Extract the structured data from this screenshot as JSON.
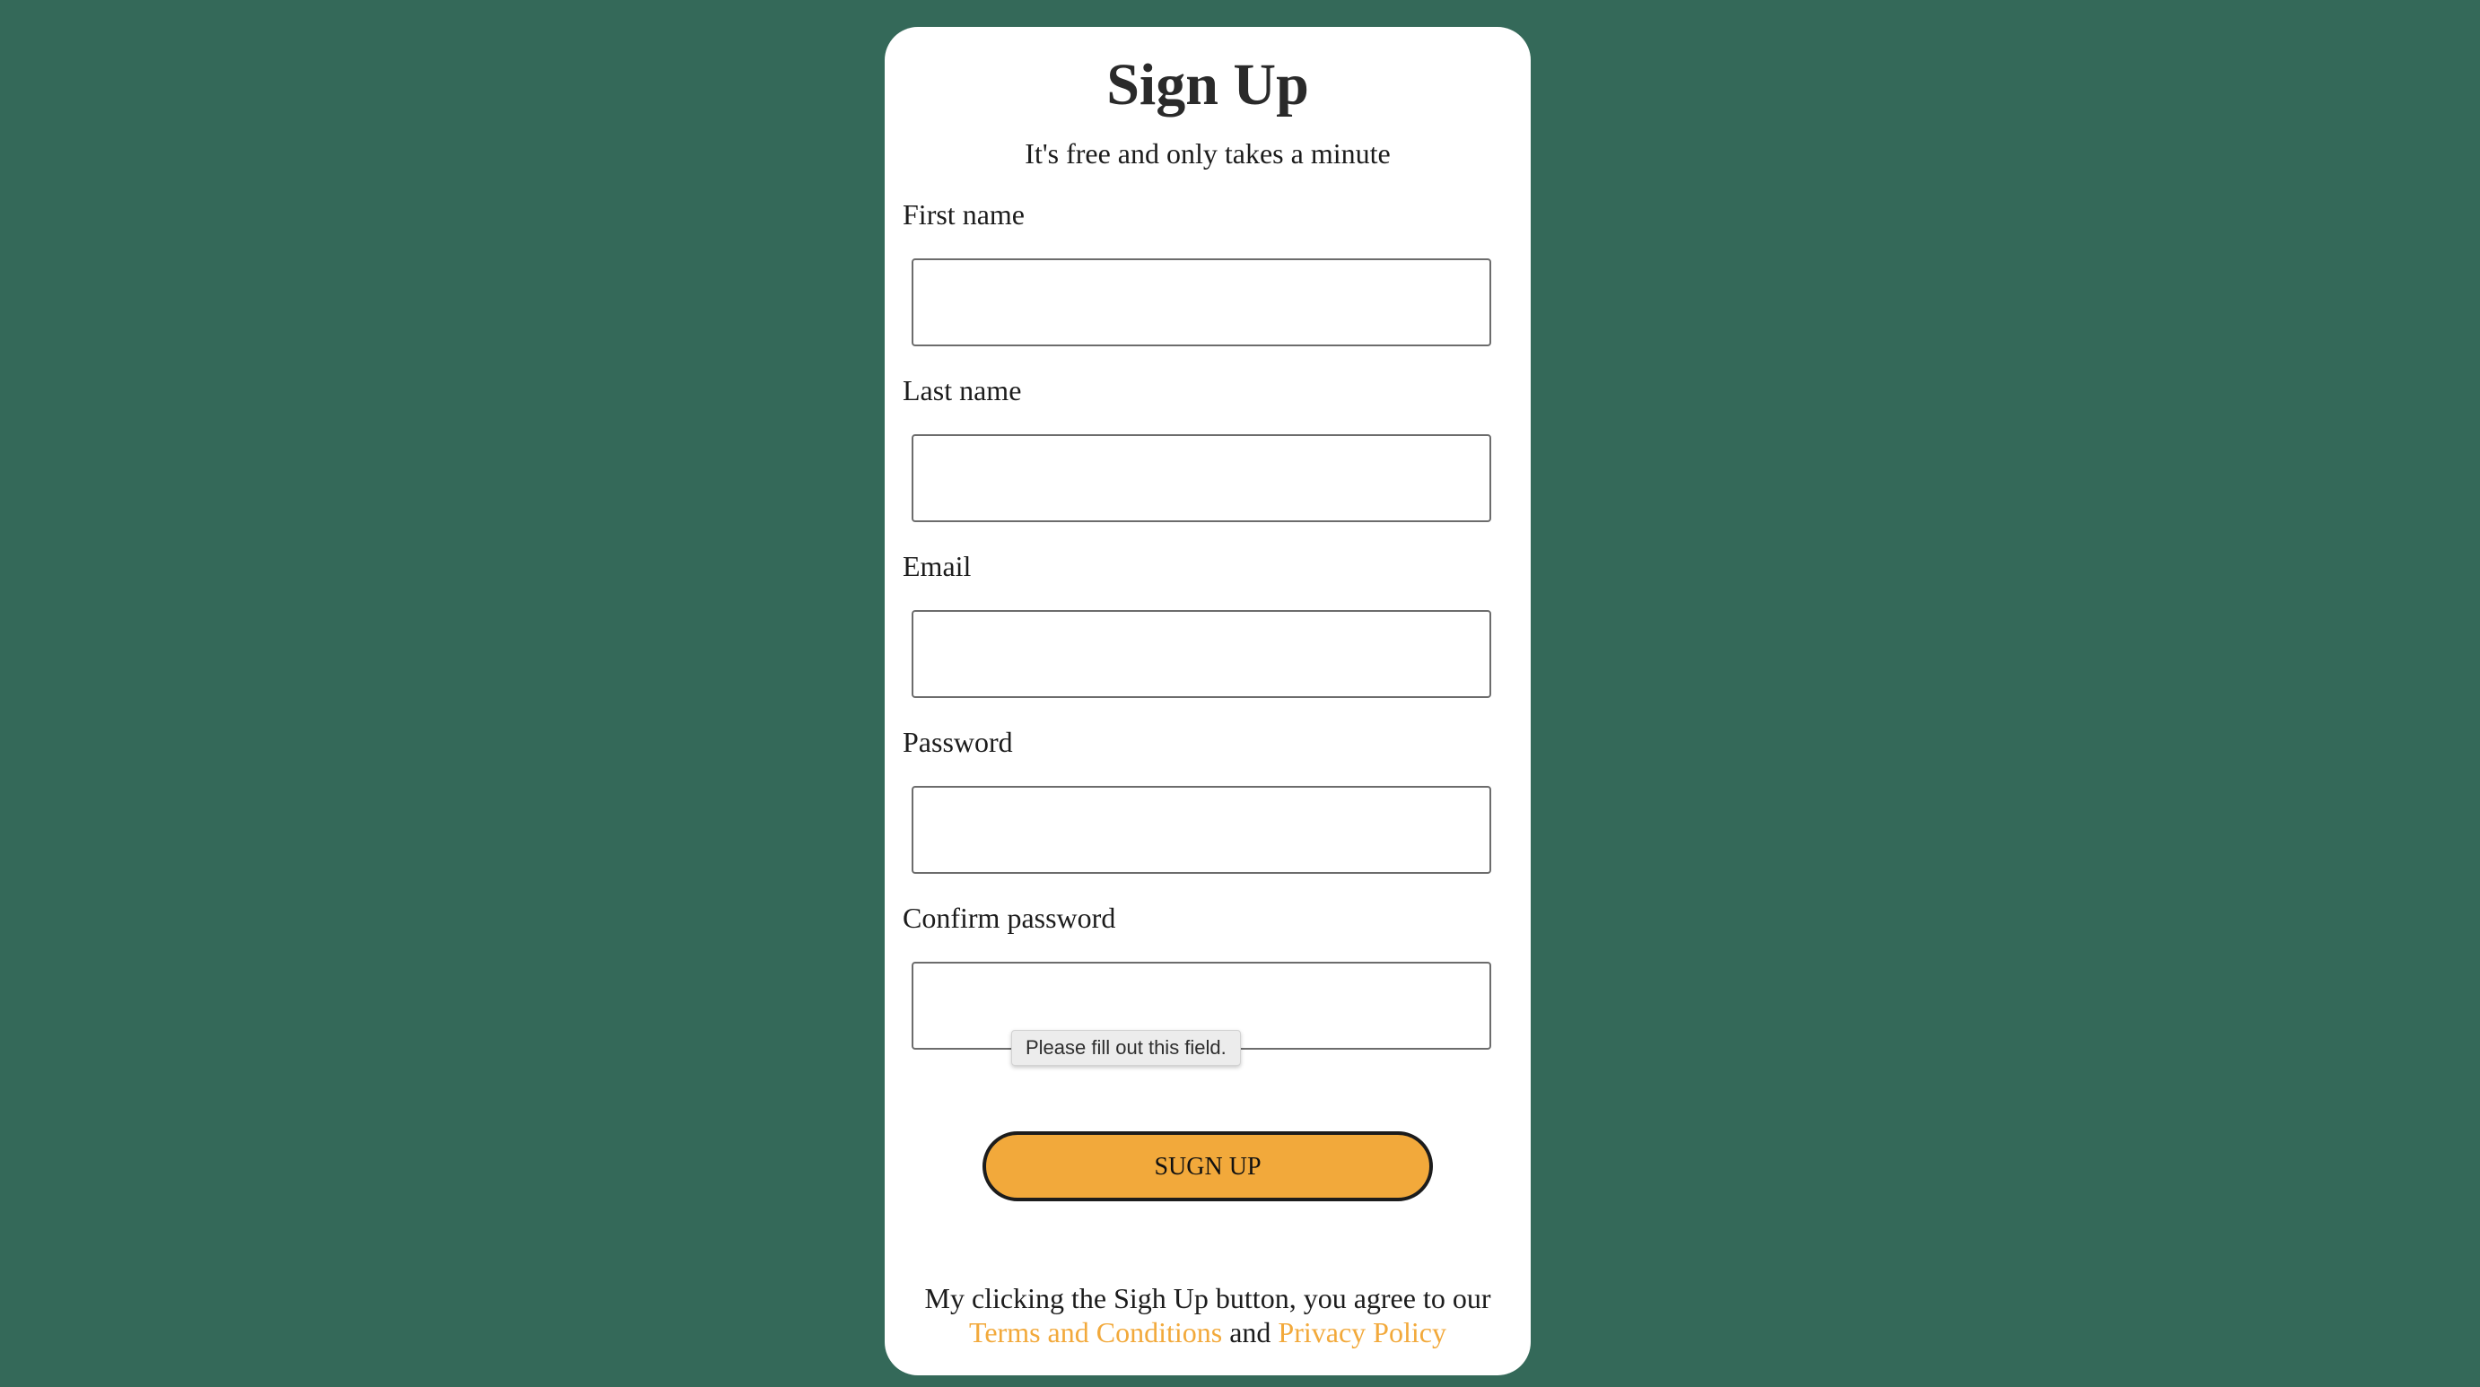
{
  "form": {
    "title": "Sign Up",
    "subtitle": "It's free and only takes a minute",
    "fields": {
      "first_name": {
        "label": "First name",
        "value": "",
        "placeholder": ""
      },
      "last_name": {
        "label": "Last name",
        "value": "",
        "placeholder": ""
      },
      "email": {
        "label": "Email",
        "value": "",
        "placeholder": ""
      },
      "password": {
        "label": "Password",
        "value": "",
        "placeholder": ""
      },
      "confirm_password": {
        "label": "Confirm password",
        "value": "",
        "placeholder": ""
      }
    },
    "validation_tooltip": "Please fill out this field.",
    "submit_label": "SUGN UP",
    "agreement": {
      "text_before": "My clicking the Sigh Up button, you agree to our",
      "terms_link": "Terms and Conditions",
      "conjunction": "and",
      "privacy_link": "Privacy Policy"
    }
  },
  "colors": {
    "background": "#346959",
    "card": "#ffffff",
    "accent": "#f2a93b",
    "text": "#1c1c1c"
  }
}
